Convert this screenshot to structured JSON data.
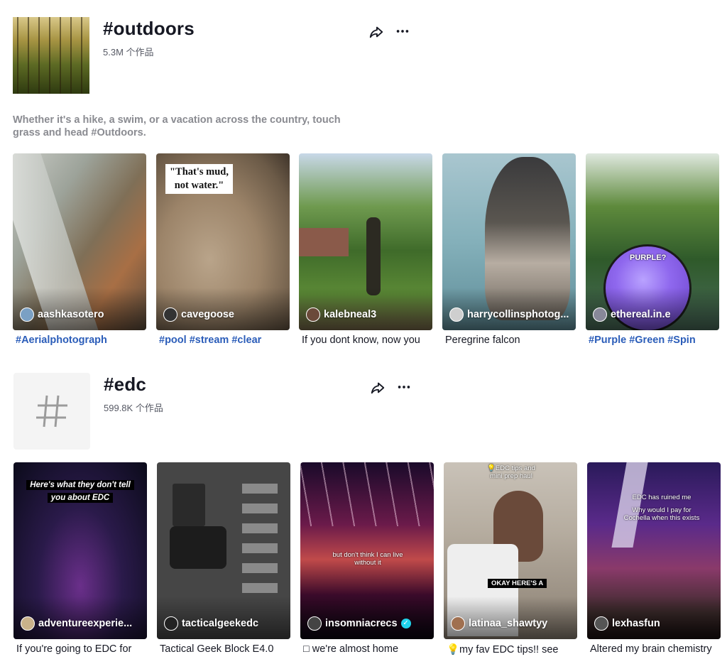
{
  "sections": [
    {
      "title": "#outdoors",
      "count": "5.3M 个作品",
      "description": "Whether it's a hike, a swim, or a vacation across the country, touch grass and head #Outdoors.",
      "videos": [
        {
          "author": "aashkasotero",
          "caption": "#Aerialphotograph",
          "caption_type": "tags"
        },
        {
          "author": "cavegoose",
          "caption": "#pool #stream #clear",
          "caption_type": "tags",
          "overlay": "\"That's mud,\nnot water.\""
        },
        {
          "author": "kalebneal3",
          "caption": "If you dont know, now you",
          "caption_type": "text"
        },
        {
          "author": "harrycollinsphotog...",
          "caption": "Peregrine falcon",
          "caption_type": "text"
        },
        {
          "author": "ethereal.in.e",
          "caption": "#Purple #Green #Spin",
          "caption_type": "tags",
          "overlay": "PURPLE?"
        }
      ]
    },
    {
      "title": "#edc",
      "count": "599.8K 个作品",
      "videos": [
        {
          "author": "adventureexperie...",
          "caption": "If you're going to EDC for",
          "caption_type": "text",
          "overlay_lines": [
            "Here's what they don't tell",
            "you about EDC"
          ]
        },
        {
          "author": "tacticalgeekedc",
          "caption": "Tactical Geek Block E4.0",
          "caption_type": "text"
        },
        {
          "author": "insomniacrecs",
          "caption": "□ we're almost home",
          "caption_type": "text",
          "verified": true,
          "overlay": "but don't think I can live without it"
        },
        {
          "author": "latinaa_shawtyy",
          "caption": "💡my fav EDC tips!! see",
          "caption_type": "text",
          "overlay": "💡EDC tips and\nmini prep haul",
          "overlay2": "OKAY HERE'S A"
        },
        {
          "author": "lexhasfun",
          "caption": "Altered my brain chemistry",
          "caption_type": "text",
          "overlay": "EDC has ruined me",
          "overlay2": "Why would I pay for\nCochella when this exists"
        }
      ]
    }
  ],
  "icons": {
    "share": "share-arrow-icon",
    "more": "more-dots-icon",
    "hashtag": "hashtag-icon"
  },
  "colors": {
    "hashtag_link": "#2b5db9",
    "verified": "#20d5ec",
    "muted": "#8a8b91"
  }
}
